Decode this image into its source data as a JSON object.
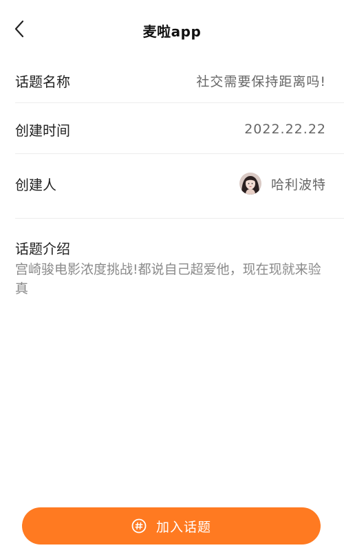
{
  "header": {
    "title": "麦啦app"
  },
  "topic": {
    "name_label": "话题名称",
    "name_value": "社交需要保持距离吗!",
    "created_label": "创建时间",
    "created_value": "2022.22.22",
    "creator_label": "创建人",
    "creator_name": "哈利波特",
    "intro_label": "话题介绍",
    "intro_text": "宫崎骏电影浓度挑战!都说自己超爱他，现在现就来验真"
  },
  "actions": {
    "join_label": "加入话题"
  },
  "colors": {
    "accent": "#ff7a21",
    "divider": "#ececec"
  },
  "icons": {
    "back": "chevron-left-icon",
    "join": "hashtag-icon"
  }
}
